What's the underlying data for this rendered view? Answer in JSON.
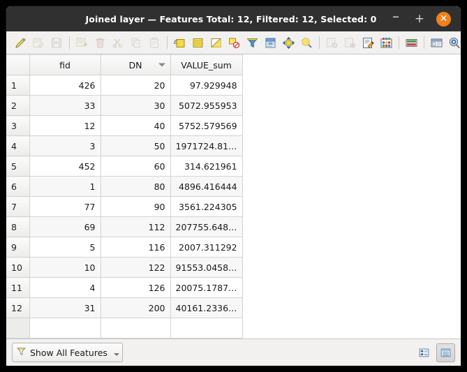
{
  "window": {
    "title": "Joined layer — Features Total: 12, Filtered: 12, Selected: 0",
    "minimize_label": "–",
    "maximize_label": "+",
    "close_label": "✕",
    "close_color": "#f0811a",
    "titlebar_color": "#303030"
  },
  "toolbar": {
    "items": [
      {
        "name": "toggle-editing-icon",
        "title": "Toggle editing mode",
        "disabled": false
      },
      {
        "name": "save-edits-icon",
        "title": "Save edits",
        "disabled": true
      },
      {
        "name": "reload-table-icon",
        "title": "Reload the table",
        "disabled": true
      },
      {
        "separator": true
      },
      {
        "name": "add-feature-icon",
        "title": "Add feature",
        "disabled": true
      },
      {
        "name": "delete-selected-icon",
        "title": "Delete selected features",
        "disabled": true
      },
      {
        "name": "cut-features-icon",
        "title": "Cut selected features to clipboard",
        "disabled": true
      },
      {
        "name": "copy-features-icon",
        "title": "Copy selected features to clipboard",
        "disabled": true
      },
      {
        "name": "paste-features-icon",
        "title": "Paste features from clipboard",
        "disabled": true
      },
      {
        "separator": true
      },
      {
        "name": "select-by-expression-icon",
        "title": "Select features using an expression",
        "disabled": false
      },
      {
        "name": "select-all-icon",
        "title": "Select all features",
        "disabled": false
      },
      {
        "name": "invert-selection-icon",
        "title": "Invert selection",
        "disabled": false
      },
      {
        "name": "deselect-all-icon",
        "title": "Deselect all features",
        "disabled": false
      },
      {
        "name": "filter-selection-icon",
        "title": "Filter / Select features using form",
        "disabled": false
      },
      {
        "name": "move-selection-to-top-icon",
        "title": "Move selection to top",
        "disabled": false
      },
      {
        "name": "pan-map-to-selection-icon",
        "title": "Pan map to the selected rows",
        "disabled": false
      },
      {
        "name": "zoom-map-to-selection-icon",
        "title": "Zoom map to the selected rows",
        "disabled": false
      },
      {
        "separator": true
      },
      {
        "name": "new-field-icon",
        "title": "New field",
        "disabled": true
      },
      {
        "name": "delete-field-icon",
        "title": "Delete field",
        "disabled": true
      },
      {
        "name": "open-field-calculator-icon",
        "title": "Open field calculator",
        "disabled": false
      },
      {
        "name": "conditional-formatting-icon",
        "title": "Conditional formatting",
        "disabled": false
      },
      {
        "separator": true
      },
      {
        "name": "multi-edit-icon",
        "title": "Toggle multi edit mode",
        "disabled": false
      },
      {
        "separator": true
      },
      {
        "name": "form-view-icon",
        "title": "Open form",
        "disabled": false
      },
      {
        "name": "actions-icon",
        "title": "Actions",
        "disabled": false
      }
    ]
  },
  "table": {
    "row_header_column": "",
    "columns": [
      {
        "key": "fid",
        "label": "fid",
        "sorted": false
      },
      {
        "key": "dn",
        "label": "DN",
        "sorted": true,
        "sort_direction": "desc"
      },
      {
        "key": "value_sum",
        "label": "VALUE_sum",
        "sorted": false
      }
    ],
    "rows": [
      {
        "n": "1",
        "fid": "426",
        "dn": "20",
        "value_sum": "97.929948"
      },
      {
        "n": "2",
        "fid": "33",
        "dn": "30",
        "value_sum": "5072.955953"
      },
      {
        "n": "3",
        "fid": "12",
        "dn": "40",
        "value_sum": "5752.579569"
      },
      {
        "n": "4",
        "fid": "3",
        "dn": "50",
        "value_sum": "1971724.81…"
      },
      {
        "n": "5",
        "fid": "452",
        "dn": "60",
        "value_sum": "314.621961"
      },
      {
        "n": "6",
        "fid": "1",
        "dn": "80",
        "value_sum": "4896.416444"
      },
      {
        "n": "7",
        "fid": "77",
        "dn": "90",
        "value_sum": "3561.224305"
      },
      {
        "n": "8",
        "fid": "69",
        "dn": "112",
        "value_sum": "207755.648…"
      },
      {
        "n": "9",
        "fid": "5",
        "dn": "116",
        "value_sum": "2007.311292"
      },
      {
        "n": "10",
        "fid": "10",
        "dn": "122",
        "value_sum": "91553.0458…"
      },
      {
        "n": "11",
        "fid": "4",
        "dn": "126",
        "value_sum": "20075.1787…"
      },
      {
        "n": "12",
        "fid": "31",
        "dn": "200",
        "value_sum": "40161.2336…"
      }
    ]
  },
  "statusbar": {
    "filter_label": "Show All Features",
    "filter_icon": "funnel-icon",
    "view_buttons": [
      {
        "name": "form-view-toggle",
        "label": "Switch to form view",
        "active": false
      },
      {
        "name": "table-view-toggle",
        "label": "Switch to table view",
        "active": true
      }
    ]
  }
}
